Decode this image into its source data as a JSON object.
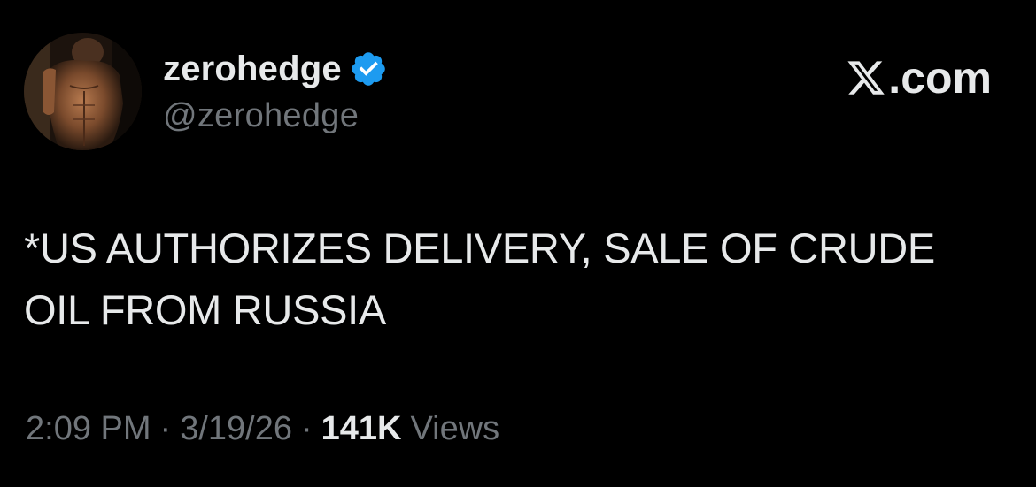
{
  "tweet": {
    "author": {
      "display_name": "zerohedge",
      "handle": "@zerohedge",
      "verified": true,
      "verified_badge_icon": "verified-checkmark-icon",
      "avatar_icon": "profile-avatar-image"
    },
    "platform": {
      "logo_icon": "x-logo-icon",
      "domain": ".com"
    },
    "text": "*US AUTHORIZES DELIVERY, SALE OF CRUDE\nOIL FROM RUSSIA",
    "meta": {
      "time": "2:09 PM",
      "separator": "·",
      "date": "3/19/26",
      "views_count": "141K",
      "views_label": "Views"
    }
  },
  "colors": {
    "background": "#000000",
    "primary_text": "#e7e9ea",
    "secondary_text": "#71767b",
    "verified_blue": "#1d9bf0"
  }
}
